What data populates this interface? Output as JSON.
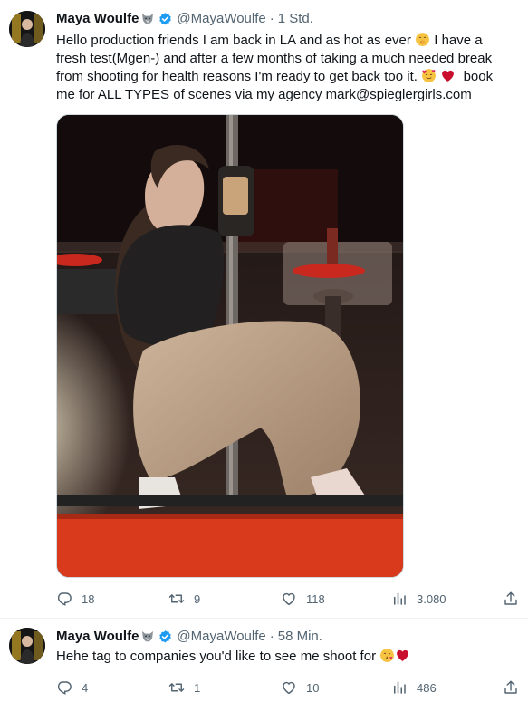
{
  "tweets": [
    {
      "name": "Maya Woulfe",
      "handle": "@MayaWoulfe",
      "time": "1 Std.",
      "text_lines": [
        "Hello production friends I am back in LA and as hot as ever",
        "I have a",
        "fresh test(Mgen-) and after a few months of taking a much needed break",
        "from shooting for health reasons I'm ready to get back too it.",
        "book",
        "me for ALL TYPES of scenes via my agency mark@spieglergirls.com"
      ],
      "replies": "18",
      "retweets": "9",
      "likes": "118",
      "views": "3.080"
    },
    {
      "name": "Maya Woulfe",
      "handle": "@MayaWoulfe",
      "time": "58 Min.",
      "text_lines": [
        "Hehe tag to companies you'd like to see me shoot for"
      ],
      "replies": "4",
      "retweets": "1",
      "likes": "10",
      "views": "486"
    }
  ],
  "icons": {
    "reply": "reply-icon",
    "retweet": "retweet-icon",
    "like": "like-icon",
    "views": "views-icon",
    "share": "share-icon",
    "verified": "verified-badge-icon",
    "wolf": "wolf-emoji-icon"
  },
  "colors": {
    "text": "#0f1419",
    "muted": "#536471",
    "verified": "#1d9bf0",
    "border": "#eff3f4"
  }
}
